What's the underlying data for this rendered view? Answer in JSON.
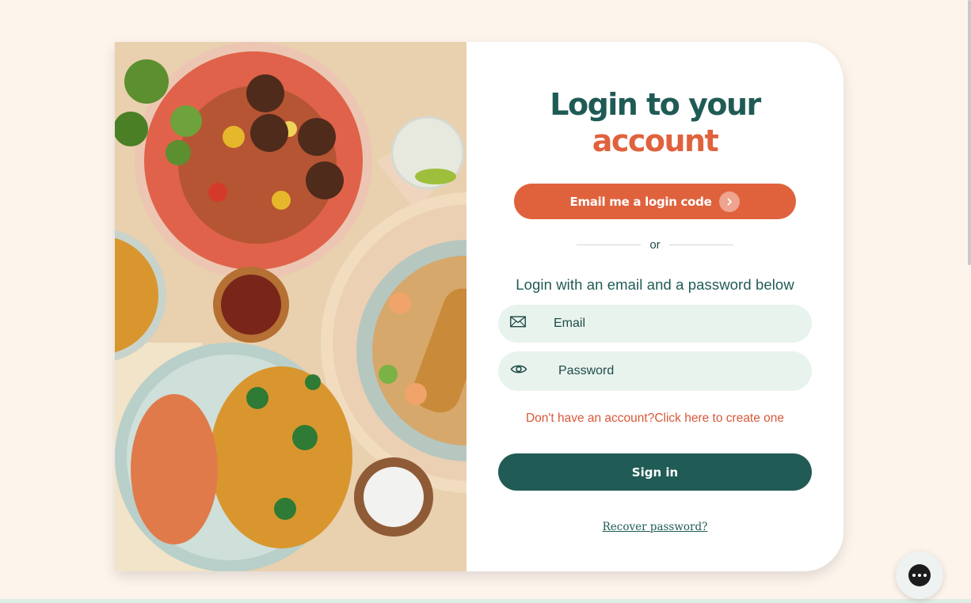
{
  "login": {
    "title_line1": "Login to your",
    "title_line2": "account",
    "email_code_button": "Email me a login code",
    "divider_text": "or",
    "subtitle": "Login with an email and a password below",
    "email_placeholder": "Email",
    "password_placeholder": "Password",
    "signup_link": "Don't have an account?Click here to create one",
    "signin_button": "Sign in",
    "recover_link": "Recover password?"
  },
  "icons": {
    "email_field": "envelope-icon",
    "password_field": "eye-icon",
    "email_code_button": "chevron-right-icon",
    "chat": "chat-dots-icon"
  },
  "colors": {
    "brand_green": "#205b55",
    "brand_orange": "#e0623d",
    "field_bg": "#e9f3ee",
    "page_bg": "#fdf4ec"
  }
}
